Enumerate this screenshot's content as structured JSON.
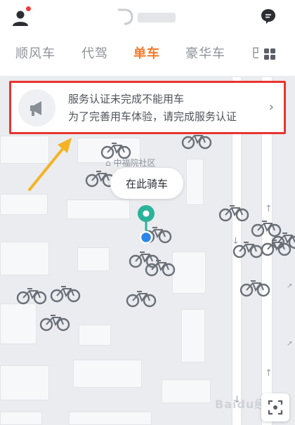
{
  "header": {
    "avatar_icon": "user-icon",
    "logo_icon": "didi-logo-icon",
    "messages_icon": "message-bubble-icon"
  },
  "tabs": [
    {
      "label": "顺风车",
      "active": false
    },
    {
      "label": "代驾",
      "active": false
    },
    {
      "label": "单车",
      "active": true
    },
    {
      "label": "豪华车",
      "active": false
    },
    {
      "label": "巴",
      "active": false
    }
  ],
  "more_tabs_icon": "grid-icon",
  "notice": {
    "icon": "megaphone-icon",
    "line1": "服务认证未完成不能用车",
    "line2": "为了完善用车体验，请完成服务认证",
    "highlight_color": "#e8342f"
  },
  "map": {
    "poi_label": "中福院社区",
    "pin_bubble": "在此骑车",
    "pin_color": "#2bb39a",
    "location_dot_color": "#2a86e8"
  },
  "watermark": "Baidu经验",
  "colors": {
    "accent": "#f5782a",
    "tab_inactive": "#8e9299",
    "annotation_arrow": "#f5b324"
  }
}
